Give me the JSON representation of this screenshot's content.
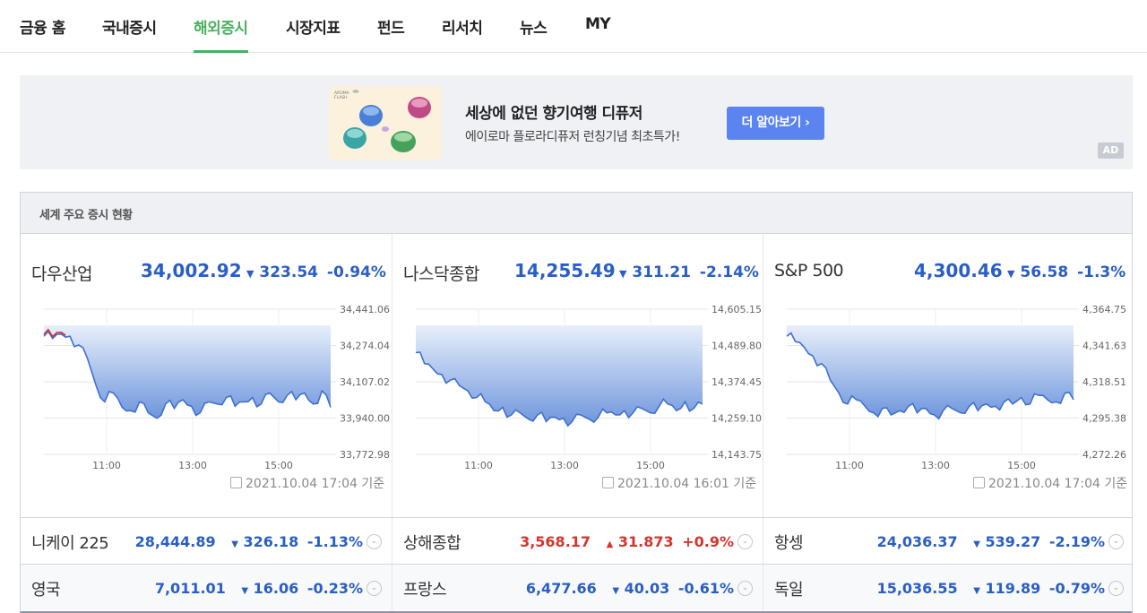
{
  "nav": {
    "items": [
      {
        "label": "금융 홈"
      },
      {
        "label": "국내증시"
      },
      {
        "label": "해외증시"
      },
      {
        "label": "시장지표"
      },
      {
        "label": "펀드"
      },
      {
        "label": "리서치"
      },
      {
        "label": "뉴스"
      },
      {
        "label": "MY"
      }
    ],
    "active_index": 2,
    "active_color": "#4ab05f"
  },
  "ad": {
    "title": "세상에 없던 향기여행 디퓨저",
    "description": "에이로마 플로라디퓨저 런칭기념 최초특가!",
    "button_label": "더 알아보기 ›",
    "tag": "AD",
    "button_color": "#5b84f0"
  },
  "market": {
    "title": "세계 주요 증시 현황",
    "main_indices": [
      {
        "name": "다우산업",
        "value": "34,002.92",
        "arrow": "▼",
        "change": "323.54",
        "percent": "-0.94%",
        "basis": "2021.10.04 17:04 기준",
        "y_ticks": [
          "34,441.06",
          "34,274.04",
          "34,107.02",
          "33,940.00",
          "33,772.98"
        ],
        "x_ticks": [
          "11:00",
          "13:00",
          "15:00"
        ]
      },
      {
        "name": "나스닥종합",
        "value": "14,255.49",
        "arrow": "▼",
        "change": "311.21",
        "percent": "-2.14%",
        "basis": "2021.10.04 16:01 기준",
        "y_ticks": [
          "14,605.15",
          "14,489.80",
          "14,374.45",
          "14,259.10",
          "14,143.75"
        ],
        "x_ticks": [
          "11:00",
          "13:00",
          "15:00"
        ]
      },
      {
        "name": "S&P 500",
        "value": "4,300.46",
        "arrow": "▼",
        "change": "56.58",
        "percent": "-1.3%",
        "basis": "2021.10.04 17:04 기준",
        "y_ticks": [
          "4,364.75",
          "4,341.63",
          "4,318.51",
          "4,295.38",
          "4,272.26"
        ],
        "x_ticks": [
          "11:00",
          "13:00",
          "15:00"
        ]
      }
    ],
    "other_indices": [
      [
        {
          "name": "니케이 225",
          "value": "28,444.89",
          "arrow": "▼",
          "change": "326.18",
          "percent": "-1.13%",
          "direction": "down"
        },
        {
          "name": "상해종합",
          "value": "3,568.17",
          "arrow": "▲",
          "change": "31.873",
          "percent": "+0.9%",
          "direction": "up"
        },
        {
          "name": "항셍",
          "value": "24,036.37",
          "arrow": "▼",
          "change": "539.27",
          "percent": "-2.19%",
          "direction": "down"
        }
      ],
      [
        {
          "name": "영국",
          "value": "7,011.01",
          "arrow": "▼",
          "change": "16.06",
          "percent": "-0.23%",
          "direction": "down"
        },
        {
          "name": "프랑스",
          "value": "6,477.66",
          "arrow": "▼",
          "change": "40.03",
          "percent": "-0.61%",
          "direction": "down"
        },
        {
          "name": "독일",
          "value": "15,036.55",
          "arrow": "▼",
          "change": "119.89",
          "percent": "-0.79%",
          "direction": "down"
        }
      ]
    ],
    "colors": {
      "down": "#2a5ec5",
      "up": "#d6342e",
      "line": "#3f6fd0"
    }
  }
}
